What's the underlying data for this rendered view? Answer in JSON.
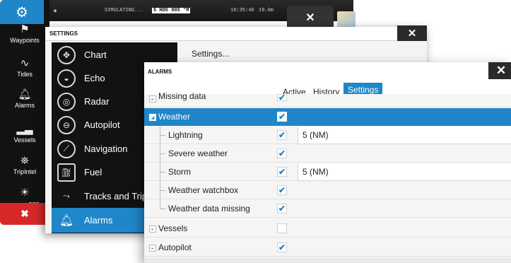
{
  "sidebar": {
    "settings_icon": "gear-icon",
    "items": [
      {
        "label": "Waypoints",
        "icon": "waypoint-flag-icon"
      },
      {
        "label": "Tides",
        "icon": "tide-wave-icon"
      },
      {
        "label": "Alarms",
        "icon": "bell-icon"
      },
      {
        "label": "Vessels",
        "icon": "vessel-icon"
      },
      {
        "label": "TripIntel",
        "icon": "tripintel-icon"
      },
      {
        "label": "oon",
        "icon": "sun-moon-icon"
      }
    ],
    "close_icon": "close-icon"
  },
  "statusbar": {
    "mode": "SIMULATING...",
    "heading_value": "5 HDG 005 °M",
    "time": "10:35:40",
    "depth": "19.0m",
    "close_icon": "close-icon"
  },
  "settings": {
    "title": "SETTINGS",
    "right_text": "Settings...",
    "menu": [
      {
        "label": "Chart",
        "icon": "chart-icon"
      },
      {
        "label": "Echo",
        "icon": "echo-icon"
      },
      {
        "label": "Radar",
        "icon": "radar-icon"
      },
      {
        "label": "Autopilot",
        "icon": "steering-wheel-icon"
      },
      {
        "label": "Navigation",
        "icon": "compass-icon"
      },
      {
        "label": "Fuel",
        "icon": "fuel-pump-icon"
      },
      {
        "label": "Tracks and Trips",
        "icon": "tracks-icon"
      },
      {
        "label": "Alarms",
        "icon": "bell-icon",
        "selected": true
      }
    ]
  },
  "alarms": {
    "title": "ALARMS",
    "tabs": [
      "Active",
      "History",
      "Settings"
    ],
    "active_tab": "Settings",
    "rows": [
      {
        "label": "Missing data",
        "checked": true,
        "partial": true
      },
      {
        "label": "Weather",
        "checked": true,
        "group": true,
        "expanded": true,
        "highlight": true
      },
      {
        "label": "Lightning",
        "checked": true,
        "child": true,
        "value": "5 (NM)"
      },
      {
        "label": "Severe weather",
        "checked": true,
        "child": true
      },
      {
        "label": "Storm",
        "checked": true,
        "child": true,
        "value": "5 (NM)"
      },
      {
        "label": "Weather watchbox",
        "checked": true,
        "child": true
      },
      {
        "label": "Weather data missing",
        "checked": true,
        "child": true,
        "last_child": true
      },
      {
        "label": "Vessels",
        "checked": false,
        "group": true
      },
      {
        "label": "Autopilot",
        "checked": true,
        "group": true
      }
    ]
  },
  "colors": {
    "accent": "#1f86c8",
    "dark_panel": "#121212",
    "close_red": "#d62828"
  }
}
